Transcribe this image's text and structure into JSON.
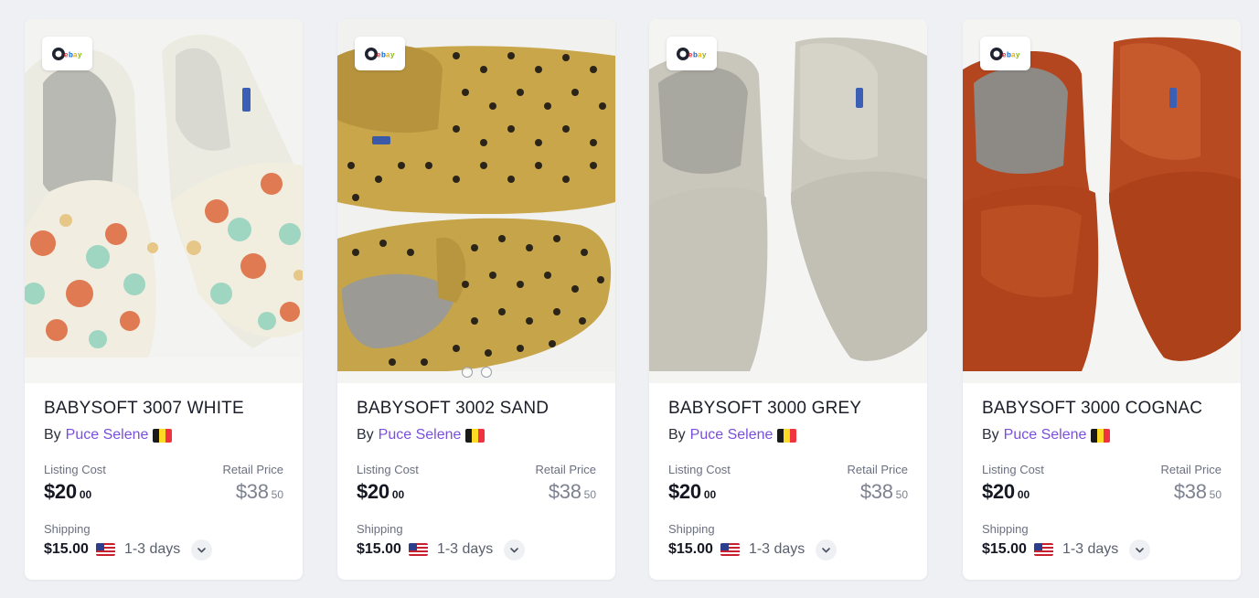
{
  "products": [
    {
      "title": "BABYSOFT 3007 WHITE",
      "by_label": "By",
      "seller": "Puce Selene",
      "seller_country": "Belgium",
      "listing_cost_label": "Listing Cost",
      "listing_cost_main": "$20",
      "listing_cost_cents": "00",
      "retail_price_label": "Retail Price",
      "retail_price_main": "$38",
      "retail_price_cents": "50",
      "shipping_label": "Shipping",
      "shipping_cost": "$15.00",
      "shipping_country": "United States",
      "shipping_days": "1-3 days",
      "marketplace": "ebay",
      "image_icon": "white-floral-leather-baby-shoes",
      "colors": {
        "base": "#eeebdf",
        "pattern": "#d9794f",
        "accent": "#9fd6c2"
      }
    },
    {
      "title": "BABYSOFT 3002 SAND",
      "by_label": "By",
      "seller": "Puce Selene",
      "seller_country": "Belgium",
      "listing_cost_label": "Listing Cost",
      "listing_cost_main": "$20",
      "listing_cost_cents": "00",
      "retail_price_label": "Retail Price",
      "retail_price_main": "$38",
      "retail_price_cents": "50",
      "shipping_label": "Shipping",
      "shipping_cost": "$15.00",
      "shipping_country": "United States",
      "shipping_days": "1-3 days",
      "marketplace": "ebay",
      "image_icon": "sand-polka-dot-suede-baby-shoes",
      "colors": {
        "base": "#c9a64a",
        "pattern": "#2b2418",
        "accent": "#b08f3c"
      }
    },
    {
      "title": "BABYSOFT 3000 GREY",
      "by_label": "By",
      "seller": "Puce Selene",
      "seller_country": "Belgium",
      "listing_cost_label": "Listing Cost",
      "listing_cost_main": "$20",
      "listing_cost_cents": "00",
      "retail_price_label": "Retail Price",
      "retail_price_main": "$38",
      "retail_price_cents": "50",
      "shipping_label": "Shipping",
      "shipping_cost": "$15.00",
      "shipping_country": "United States",
      "shipping_days": "1-3 days",
      "marketplace": "ebay",
      "image_icon": "grey-leather-baby-shoes",
      "colors": {
        "base": "#c8c6ba",
        "pattern": "#aeaca0",
        "accent": "#dcdad0"
      }
    },
    {
      "title": "BABYSOFT 3000 COGNAC",
      "by_label": "By",
      "seller": "Puce Selene",
      "seller_country": "Belgium",
      "listing_cost_label": "Listing Cost",
      "listing_cost_main": "$20",
      "listing_cost_cents": "00",
      "retail_price_label": "Retail Price",
      "retail_price_main": "$38",
      "retail_price_cents": "50",
      "shipping_label": "Shipping",
      "shipping_cost": "$15.00",
      "shipping_country": "United States",
      "shipping_days": "1-3 days",
      "marketplace": "ebay",
      "image_icon": "cognac-leather-baby-shoes",
      "colors": {
        "base": "#b4461f",
        "pattern": "#8e3214",
        "accent": "#cf6a3c"
      }
    }
  ],
  "carousel": {
    "card_index": 1,
    "dot_count": 2
  },
  "colors": {
    "accent": "#7a4fdc",
    "background": "#eef0f4",
    "card": "#ffffff",
    "muted_text": "#6b7080"
  }
}
